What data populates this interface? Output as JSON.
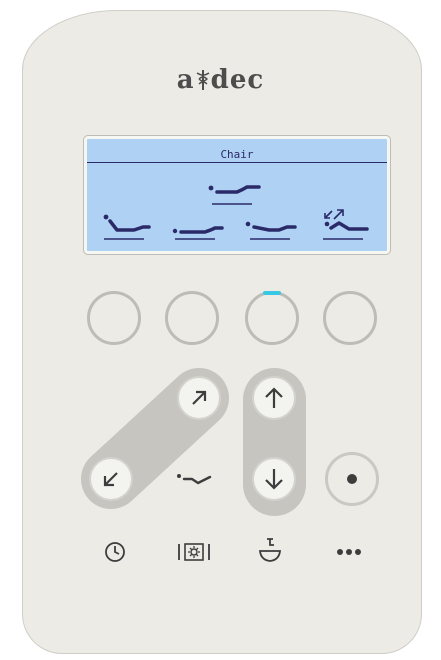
{
  "brand": {
    "logo_text": "adec",
    "logo_alt": "A-dec"
  },
  "display": {
    "title": "Chair",
    "selected_position": "chair-position-center",
    "presets": [
      "chair-preset-1",
      "chair-preset-2",
      "chair-preset-3",
      "chair-preset-4"
    ]
  },
  "colors": {
    "panel": "#ecebe6",
    "screen": "#aed1f4",
    "screen_ink": "#2a2a68",
    "icon_ink": "#3d3d3d",
    "indicator": "#39c7e6"
  },
  "controls": {
    "preset_buttons": [
      "preset-button-1",
      "preset-button-2",
      "preset-button-3",
      "preset-button-4"
    ],
    "active_preset_index": 3,
    "move_buttons": [
      "arrow-up-right-icon",
      "arrow-down-left-icon",
      "arrow-up-icon",
      "arrow-down-icon",
      "record-dot-icon"
    ],
    "bottom_icons": [
      "clock-icon",
      "light-icon",
      "cuspidor-icon",
      "more-icon"
    ]
  }
}
